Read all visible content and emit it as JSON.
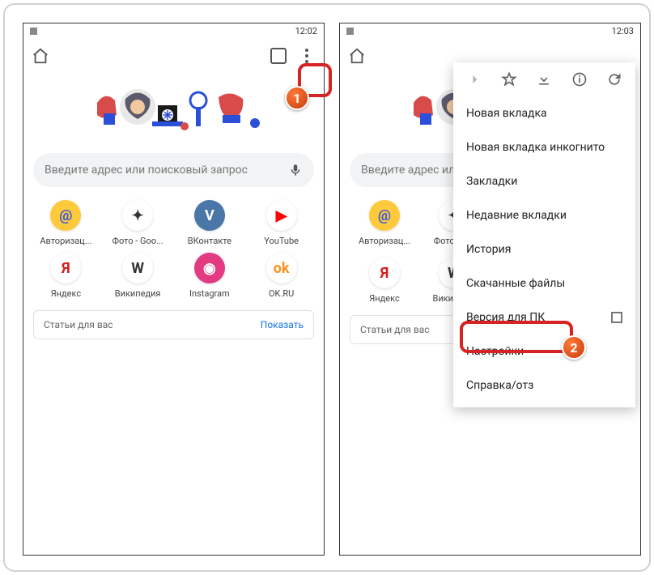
{
  "left": {
    "status": {
      "time": "12:02"
    },
    "search": {
      "placeholder": "Введите адрес или поисковый запрос"
    },
    "shortcuts": [
      {
        "label": "Авторизац...",
        "bg": "#ffc93c",
        "fg": "#3a5bd9",
        "letter": "@"
      },
      {
        "label": "Фото - Goo...",
        "bg": "#ffffff",
        "fg": "#333",
        "letter": "✦"
      },
      {
        "label": "ВКонтакте",
        "bg": "#4a76a8",
        "fg": "#fff",
        "letter": "V"
      },
      {
        "label": "YouTube",
        "bg": "#ffffff",
        "fg": "#f00",
        "letter": "▶"
      },
      {
        "label": "Яндекс",
        "bg": "#ffffff",
        "fg": "#d61f1f",
        "letter": "Я"
      },
      {
        "label": "Википедия",
        "bg": "#ffffff",
        "fg": "#333",
        "letter": "W"
      },
      {
        "label": "Instagram",
        "bg": "#e33b81",
        "fg": "#fff",
        "letter": "◉"
      },
      {
        "label": "OK.RU",
        "bg": "#ffffff",
        "fg": "#f7931e",
        "letter": "ok"
      }
    ],
    "articles": {
      "title": "Статьи для вас",
      "action": "Показать"
    }
  },
  "right": {
    "status": {
      "time": "12:03"
    },
    "search": {
      "placeholder": "Введите адрес или по"
    },
    "shortcuts": [
      {
        "label": "Авторизац...",
        "bg": "#ffc93c",
        "fg": "#3a5bd9",
        "letter": "@"
      },
      {
        "label": "Фото - G...",
        "bg": "#ffffff",
        "fg": "#333",
        "letter": "✦"
      },
      {
        "label": "Яндекс",
        "bg": "#ffffff",
        "fg": "#d61f1f",
        "letter": "Я"
      },
      {
        "label": "Википед...",
        "bg": "#ffffff",
        "fg": "#333",
        "letter": "W"
      }
    ],
    "articles": {
      "title": "Статьи для вас"
    },
    "menu": {
      "items": [
        "Новая вкладка",
        "Новая вкладка инкогнито",
        "Закладки",
        "Недавние вкладки",
        "История",
        "Скачанные файлы"
      ],
      "desktop": "Версия для ПК",
      "settings": "Настройки",
      "help": "Справка/отз"
    }
  },
  "annotations": {
    "badge1": "1",
    "badge2": "2"
  }
}
